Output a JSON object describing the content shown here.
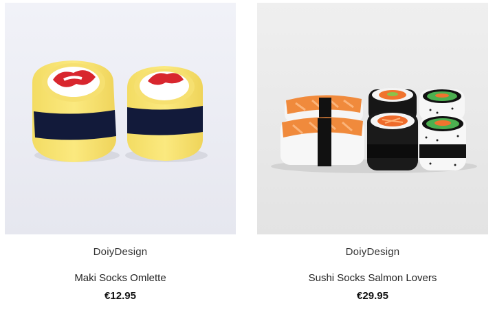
{
  "products": [
    {
      "brand": "DoiyDesign",
      "title": "Maki Socks Omlette",
      "price": "€12.95",
      "image_bg": "#ecedf4",
      "image_icon": "maki-omelette-socks-photo"
    },
    {
      "brand": "DoiyDesign",
      "title": "Sushi Socks Salmon Lovers",
      "price": "€29.95",
      "image_bg": "#eaeaea",
      "image_icon": "sushi-salmon-socks-photo"
    }
  ]
}
